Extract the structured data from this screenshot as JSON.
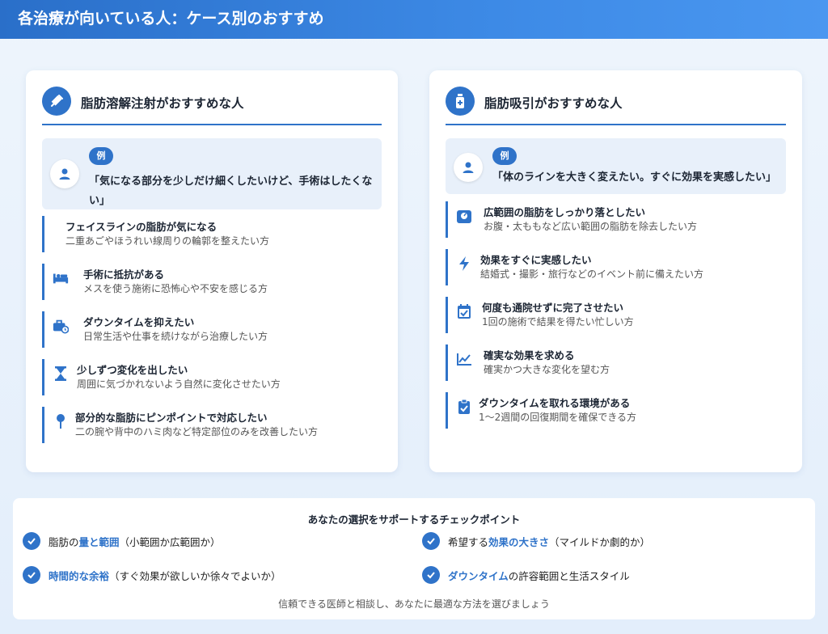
{
  "header": {
    "title": "各治療が向いている人：ケース別のおすすめ"
  },
  "left_card": {
    "title": "脂肪溶解注射がおすすめな人",
    "example_badge": "例",
    "example_text": "「気になる部分を少しだけ細くしたいけど、手術はしたくない」",
    "items": [
      {
        "icon": "face-icon",
        "title": "フェイスラインの脂肪が気になる",
        "desc": "二重あごやほうれい線周りの輪郭を整えたい方"
      },
      {
        "icon": "bed-icon",
        "title": "手術に抵抗がある",
        "desc": "メスを使う施術に恐怖心や不安を感じる方"
      },
      {
        "icon": "briefcase-clock-icon",
        "title": "ダウンタイムを抑えたい",
        "desc": "日常生活や仕事を続けながら治療したい方"
      },
      {
        "icon": "hourglass-icon",
        "title": "少しずつ変化を出したい",
        "desc": "周囲に気づかれないよう自然に変化させたい方"
      },
      {
        "icon": "map-pin-icon",
        "title": "部分的な脂肪にピンポイントで対応したい",
        "desc": "二の腕や背中のハミ肉など特定部位のみを改善したい方"
      }
    ]
  },
  "right_card": {
    "title": "脂肪吸引がおすすめな人",
    "example_badge": "例",
    "example_text": "「体のラインを大きく変えたい。すぐに効果を実感したい」",
    "items": [
      {
        "icon": "weight-icon",
        "title": "広範囲の脂肪をしっかり落としたい",
        "desc": "お腹・太ももなど広い範囲の脂肪を除去したい方"
      },
      {
        "icon": "bolt-icon",
        "title": "効果をすぐに実感したい",
        "desc": "結婚式・撮影・旅行などのイベント前に備えたい方"
      },
      {
        "icon": "calendar-check-icon",
        "title": "何度も通院せずに完了させたい",
        "desc": "1回の施術で結果を得たい忙しい方"
      },
      {
        "icon": "chart-line-icon",
        "title": "確実な効果を求める",
        "desc": "確実かつ大きな変化を望む方"
      },
      {
        "icon": "clipboard-check-icon",
        "title": "ダウンタイムを取れる環境がある",
        "desc": "1〜2週間の回復期間を確保できる方"
      }
    ]
  },
  "checkpoints": {
    "title": "あなたの選択をサポートするチェックポイント",
    "items": [
      {
        "pre": "脂肪の",
        "hl": "量と範囲",
        "post": "（小範囲か広範囲か）"
      },
      {
        "pre": "希望する",
        "hl": "効果の大きさ",
        "post": "（マイルドか劇的か）"
      },
      {
        "pre": "",
        "hl": "時間的な余裕",
        "post": "（すぐ効果が欲しいか徐々でよいか）"
      },
      {
        "pre": "",
        "hl": "ダウンタイム",
        "post": "の許容範囲と生活スタイル"
      }
    ],
    "note": "信頼できる医師と相談し、あなたに最適な方法を選びましょう"
  },
  "colors": {
    "accent": "#2f73c9",
    "header_start": "#2a6fc9",
    "header_end": "#4a97f0"
  }
}
